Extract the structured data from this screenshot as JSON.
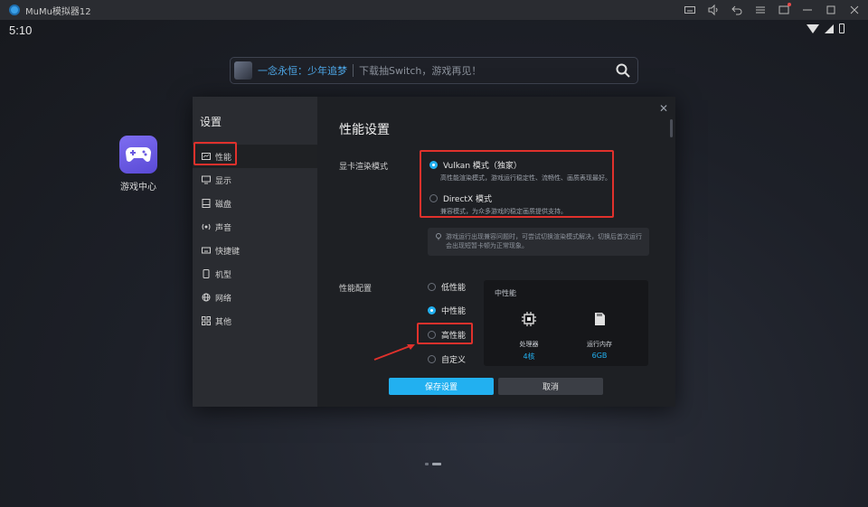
{
  "window": {
    "title": "MuMu模拟器12",
    "toolbar_icons": [
      "keyboard-icon",
      "volume-icon",
      "back-icon",
      "menu-icon",
      "notification-icon",
      "minimize-icon",
      "maximize-icon",
      "close-icon"
    ]
  },
  "status_bar": {
    "time": "5:10"
  },
  "search": {
    "hot_text": "一念永恒：少年追梦",
    "placeholder": "下载抽Switch，游戏再见！"
  },
  "desktop": {
    "app_label": "游戏中心"
  },
  "dialog": {
    "sidebar_title": "设置",
    "nav": [
      {
        "label": "性能",
        "icon": "performance-icon",
        "active": true
      },
      {
        "label": "显示",
        "icon": "monitor-icon"
      },
      {
        "label": "磁盘",
        "icon": "disk-icon"
      },
      {
        "label": "声音",
        "icon": "sound-icon"
      },
      {
        "label": "快捷键",
        "icon": "keyboard-icon"
      },
      {
        "label": "机型",
        "icon": "phone-icon"
      },
      {
        "label": "网络",
        "icon": "network-icon"
      },
      {
        "label": "其他",
        "icon": "grid-icon"
      }
    ],
    "title": "性能设置",
    "render": {
      "label": "显卡渲染模式",
      "options": [
        {
          "name": "Vulkan 模式（独家）",
          "desc": "高性能渲染模式，游戏运行稳定性、流畅性、画质表现最好。",
          "selected": true
        },
        {
          "name": "DirectX 模式",
          "desc": "兼容模式，为众多游戏的稳定画质提供支持。",
          "selected": false
        }
      ],
      "tip": "游戏运行出现兼容问题时，可尝试切换渲染模式解决，切换后首次运行会出现短暂卡顿为正常现象。"
    },
    "performance": {
      "label": "性能配置",
      "options": [
        {
          "name": "低性能",
          "selected": false
        },
        {
          "name": "中性能",
          "selected": true
        },
        {
          "name": "高性能",
          "selected": false
        },
        {
          "name": "自定义",
          "selected": false
        }
      ],
      "card_title": "中性能",
      "cpu_label": "处理器",
      "cpu_value": "4核",
      "ram_label": "运行内存",
      "ram_value": "6GB"
    },
    "save_label": "保存设置",
    "cancel_label": "取消"
  },
  "colors": {
    "accent": "#22b0f0",
    "highlight": "#e0312c"
  }
}
